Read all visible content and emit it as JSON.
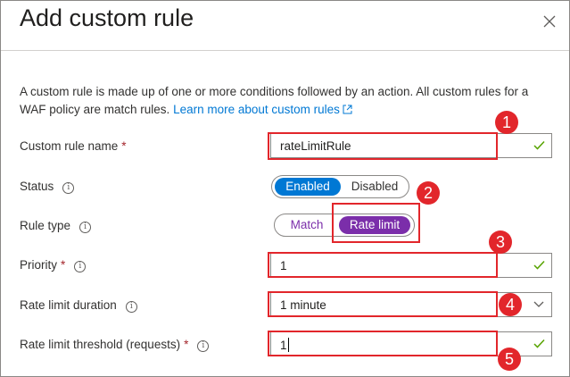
{
  "dialog": {
    "title": "Add custom rule",
    "description": "A custom rule is made up of one or more conditions followed by an action. All custom rules for a WAF policy are match rules.",
    "learn_more": "Learn more about custom rules"
  },
  "form": {
    "rule_name": {
      "label": "Custom rule name",
      "value": "rateLimitRule",
      "required": "*"
    },
    "status": {
      "label": "Status",
      "options": [
        "Enabled",
        "Disabled"
      ],
      "selected": "Enabled"
    },
    "rule_type": {
      "label": "Rule type",
      "options": [
        "Match",
        "Rate limit"
      ],
      "selected": "Rate limit"
    },
    "priority": {
      "label": "Priority",
      "value": "1",
      "required": "*"
    },
    "duration": {
      "label": "Rate limit duration",
      "value": "1 minute"
    },
    "threshold": {
      "label": "Rate limit threshold (requests)",
      "value": "1",
      "required": "*"
    }
  },
  "callouts": [
    "1",
    "2",
    "3",
    "4",
    "5"
  ],
  "colors": {
    "accent": "#0078d4",
    "purple": "#7b2eaa",
    "valid": "#57a300",
    "callout": "#e2262b"
  },
  "icons": [
    "close-icon",
    "external-link-icon",
    "info-icon",
    "checkmark-icon",
    "chevron-down-icon"
  ]
}
